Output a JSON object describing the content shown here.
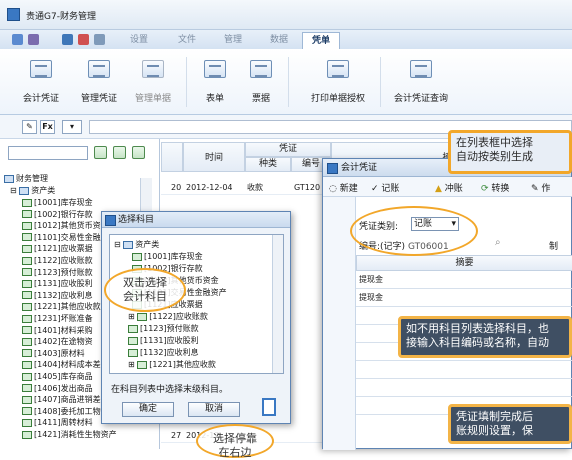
{
  "app": {
    "title": "贵通G7-财务管理"
  },
  "tabs": [
    "设置",
    "文件",
    "管理",
    "数据",
    "凭单"
  ],
  "ribbon": [
    "会计凭证",
    "管理凭证",
    "管理单据",
    "表单",
    "票据",
    "打印单据授权",
    "会计凭证查询"
  ],
  "toolbar2": {
    "btn1": "✎",
    "btn2": "Fx",
    "dropdown": "▾"
  },
  "tree": {
    "root": "财务管理",
    "group": "资产类",
    "items": [
      "[1001]库存现金",
      "[1002]银行存款",
      "[1012]其他货币资金",
      "[1101]交易性金融资产",
      "[1121]应收票据",
      "[1122]应收账款",
      "[1123]预付账款",
      "[1131]应收股利",
      "[1132]应收利息",
      "[1221]其他应收款",
      "[1231]坏账准备",
      "[1401]材料采购",
      "[1402]在途物资",
      "[1403]原材料",
      "[1404]材料成本差异",
      "[1405]库存商品",
      "[1406]发出商品",
      "[1407]商品进销差价",
      "[1408]委托加工物资",
      "[1411]周转材料",
      "[1421]消耗性生物资产"
    ]
  },
  "table": {
    "headers": {
      "time": "时间",
      "voucher": "凭证",
      "kind": "种类",
      "code": "编号"
    },
    "rows": [
      {
        "no": "20",
        "date": "2012-12-04",
        "kind": "收款",
        "code": "GT120"
      }
    ],
    "row27": {
      "no": "27",
      "date": "2012-12"
    }
  },
  "dialog": {
    "title": "选择科目",
    "group": "资产类",
    "items": [
      "[1001]库存现金",
      "[1002]银行存款",
      "[1012]其他货币资金",
      "[1101]交易性金融资产",
      "[1121]应收票据",
      "[1122]应收账款",
      "[1123]预付账款",
      "[1131]应收股利",
      "[1132]应收利息",
      "[1221]其他应收款"
    ],
    "hint": "在科目列表中选择末级科目。",
    "ok": "确定",
    "cancel": "取消"
  },
  "voucher": {
    "title": "会计凭证",
    "toolbar": [
      "新建",
      "记账",
      "冲账",
      "转换",
      "作"
    ],
    "type_label": "凭证类别:",
    "type_value": "记账",
    "number_label": "编号:",
    "number_prefix": "(记字)",
    "number_value": "GT06001",
    "summary_header": "摘要",
    "rows": [
      "提现金",
      "提现金"
    ],
    "right_header": "制"
  },
  "callouts": {
    "top": "在列表框中选择\n自动按类别生成",
    "double": "双击选择\n会计科目",
    "middle": "如不用科目列表选择科目，也\n接输入科目编码或名称，自动",
    "bottom": "凭证填制完成后\n账规则设置，保",
    "stop": "选择停靠\n在右边"
  },
  "tbl_header_top": "凭证",
  "desc_header": "摘要"
}
